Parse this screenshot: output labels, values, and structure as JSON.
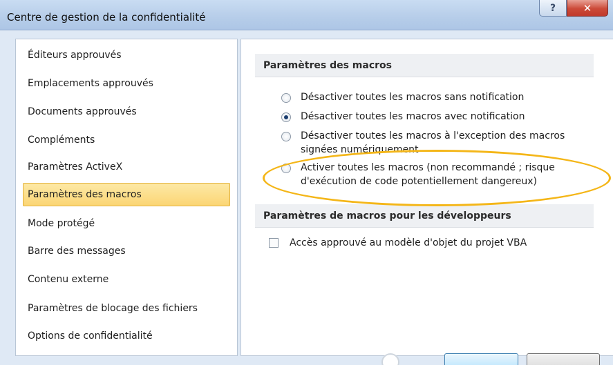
{
  "window": {
    "title": "Centre de gestion de la confidentialité",
    "help_icon": "help-icon",
    "close_icon": "close-icon"
  },
  "sidebar": {
    "items": [
      {
        "label": "Éditeurs approuvés",
        "selected": false
      },
      {
        "label": "Emplacements approuvés",
        "selected": false
      },
      {
        "label": "Documents approuvés",
        "selected": false
      },
      {
        "label": "Compléments",
        "selected": false
      },
      {
        "label": "Paramètres ActiveX",
        "selected": false
      },
      {
        "label": "Paramètres des macros",
        "selected": true
      },
      {
        "label": "Mode protégé",
        "selected": false
      },
      {
        "label": "Barre des messages",
        "selected": false
      },
      {
        "label": "Contenu externe",
        "selected": false
      },
      {
        "label": "Paramètres de blocage des fichiers",
        "selected": false
      },
      {
        "label": "Options de confidentialité",
        "selected": false
      }
    ]
  },
  "macros": {
    "header": "Paramètres des macros",
    "options": [
      {
        "label": "Désactiver toutes les macros sans notification",
        "checked": false
      },
      {
        "label": "Désactiver toutes les macros avec notification",
        "checked": true
      },
      {
        "label": "Désactiver toutes les macros à l'exception des macros signées numériquement",
        "checked": false
      },
      {
        "label": "Activer toutes les macros (non recommandé ; risque d'exécution de code potentiellement dangereux)",
        "checked": false
      }
    ]
  },
  "developer": {
    "header": "Paramètres de macros pour les développeurs",
    "vba_access": {
      "label": "Accès approuvé au modèle d'objet du projet VBA",
      "checked": false
    }
  },
  "colors": {
    "highlight": "#f4b618",
    "selected_bg": "#fbd574",
    "titlebar": "#b6cde9"
  }
}
